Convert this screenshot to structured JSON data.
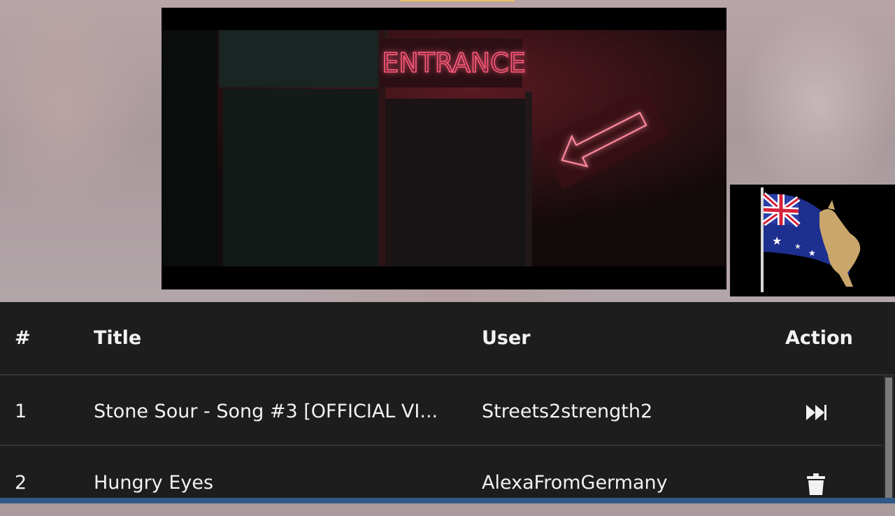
{
  "video": {
    "sign_text": "ENTRANCE",
    "sign_color": "#ff3a5a"
  },
  "overlay": {
    "icon": "australian-flag-kangaroo-icon"
  },
  "playlist": {
    "columns": [
      "#",
      "Title",
      "User",
      "Action"
    ],
    "rows": [
      {
        "num": "1",
        "title": "Stone Sour - Song #3 [OFFICIAL VI...",
        "user": "Streets2strength2",
        "action_icon": "fast-forward-icon"
      },
      {
        "num": "2",
        "title": "Hungry Eyes",
        "user": "AlexaFromGermany",
        "action_icon": "trash-icon"
      }
    ]
  },
  "colors": {
    "panel_bg": "#1d1d1d",
    "text": "#f2f2f2",
    "accent_bar": "#2f5a86"
  }
}
